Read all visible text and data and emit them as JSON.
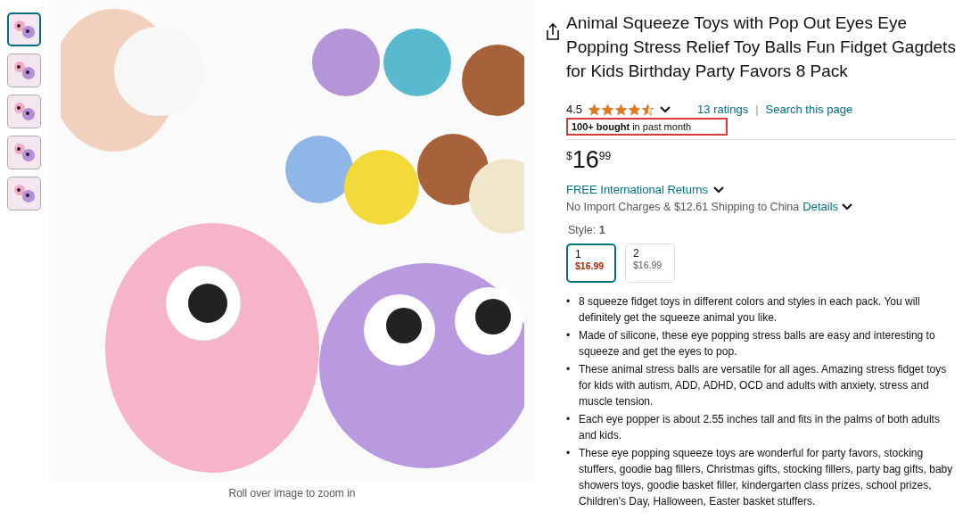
{
  "thumbnails": [
    {
      "selected": true
    },
    {
      "selected": false
    },
    {
      "selected": false
    },
    {
      "selected": false
    },
    {
      "selected": false
    }
  ],
  "image_caption": "Roll over image to zoom in",
  "title": "Animal Squeeze Toys with Pop Out Eyes Eye Popping Stress Relief Toy Balls Fun Fidget Gagdets for Kids Birthday Party Favors 8 Pack",
  "rating": {
    "value": "4.5",
    "stars": 4.5,
    "ratings_link": "13 ratings",
    "separator": "|",
    "search_link": "Search this page"
  },
  "bought": "**100+ bought** in past month",
  "price": {
    "currency": "$",
    "whole": "16",
    "fraction": "99"
  },
  "returns": "FREE International Returns",
  "shipping": {
    "text": "No Import Charges & $12.61 Shipping to China",
    "link": "Details"
  },
  "style": {
    "label": "Style:",
    "value": "1",
    "options": [
      {
        "name": "1",
        "price": "$16.99",
        "selected": true
      },
      {
        "name": "2",
        "price": "$16.99",
        "selected": false
      }
    ]
  },
  "bullets": [
    {
      "marker": "•",
      "text": "8 squeeze fidget toys in different colors and styles in each pack. You will definitely get the squeeze animal you like."
    },
    {
      "marker": "•",
      "text": "Made of silicone, these eye popping stress balls are easy and interesting to squeeze and get the eyes to pop."
    },
    {
      "marker": "•",
      "text": "These animal stress balls are versatile for all ages. Amazing stress fidget toys for kids with autism, ADD, ADHD, OCD and adults with anxiety, stress and muscle tension."
    },
    {
      "marker": "•",
      "text": "Each eye popper is about 2.55 inches tall and fits in the palms of both adults and kids."
    },
    {
      "marker": "•",
      "text": "These eye popping squeeze toys are wonderful for party favors, stocking stuffers, goodie bag fillers, Christmas gifts, stocking fillers, party bag gifts, baby showers toys, goodie basket filler, kindergarten class prizes, school prizes, Children's Day, Halloween, Easter basket stuffers."
    }
  ]
}
